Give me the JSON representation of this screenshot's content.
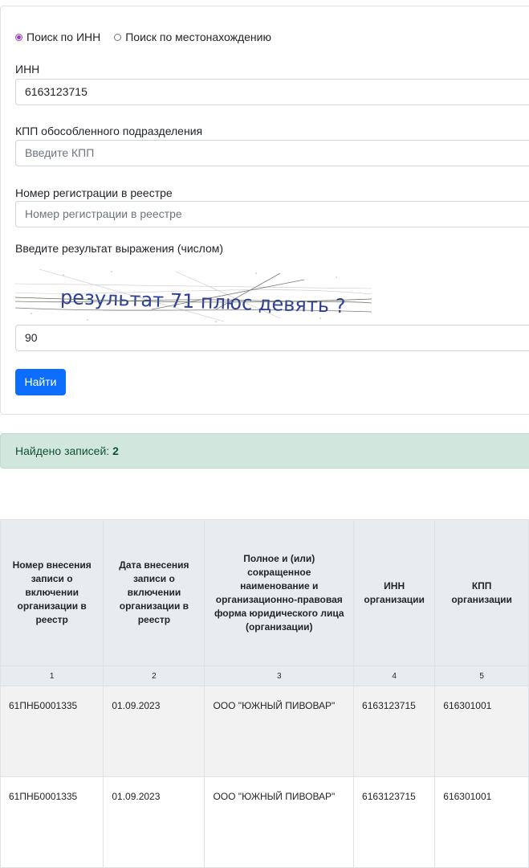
{
  "search_mode": {
    "options": [
      {
        "label": "Поиск по ИНН",
        "checked": true
      },
      {
        "label": "Поиск по местонахождению",
        "checked": false
      }
    ]
  },
  "inn": {
    "label": "ИНН",
    "value": "6163123715"
  },
  "kpp": {
    "label": "КПП обособленного подразделения",
    "placeholder": "Введите КПП"
  },
  "reg_number": {
    "label": "Номер регистрации в реестре",
    "placeholder": "Номер регистрации в реестре"
  },
  "captcha": {
    "label": "Введите результат выражения (числом)",
    "text": "результат 71 плюс девять ?",
    "answer": "90",
    "text_color": "#2e3f9a"
  },
  "submit_label": "Найти",
  "found": {
    "label": "Найдено записей:",
    "count": "2"
  },
  "table": {
    "headers": [
      "Номер внесения записи о включении организации в реестр",
      "Дата внесения записи о включении организации в реестр",
      "Полное и (или) сокращенное наименование и организационно-правовая форма юридического лица (организации)",
      "ИНН организации",
      "КПП организации"
    ],
    "column_numbers": [
      "1",
      "2",
      "3",
      "4",
      "5"
    ],
    "rows": [
      [
        "61ПНБ0001335",
        "01.09.2023",
        "ООО \"ЮЖНЫЙ ПИВОВАР\"",
        "6163123715",
        "616301001"
      ],
      [
        "61ПНБ0001335",
        "01.09.2023",
        "ООО \"ЮЖНЫЙ ПИВОВАР\"",
        "6163123715",
        "616301001"
      ]
    ]
  },
  "colors": {
    "primary": "#0d6efd",
    "radio_checked": "#9b3fc0",
    "success_bg": "#d1e7dd",
    "table_header_bg": "#e9ecef"
  }
}
